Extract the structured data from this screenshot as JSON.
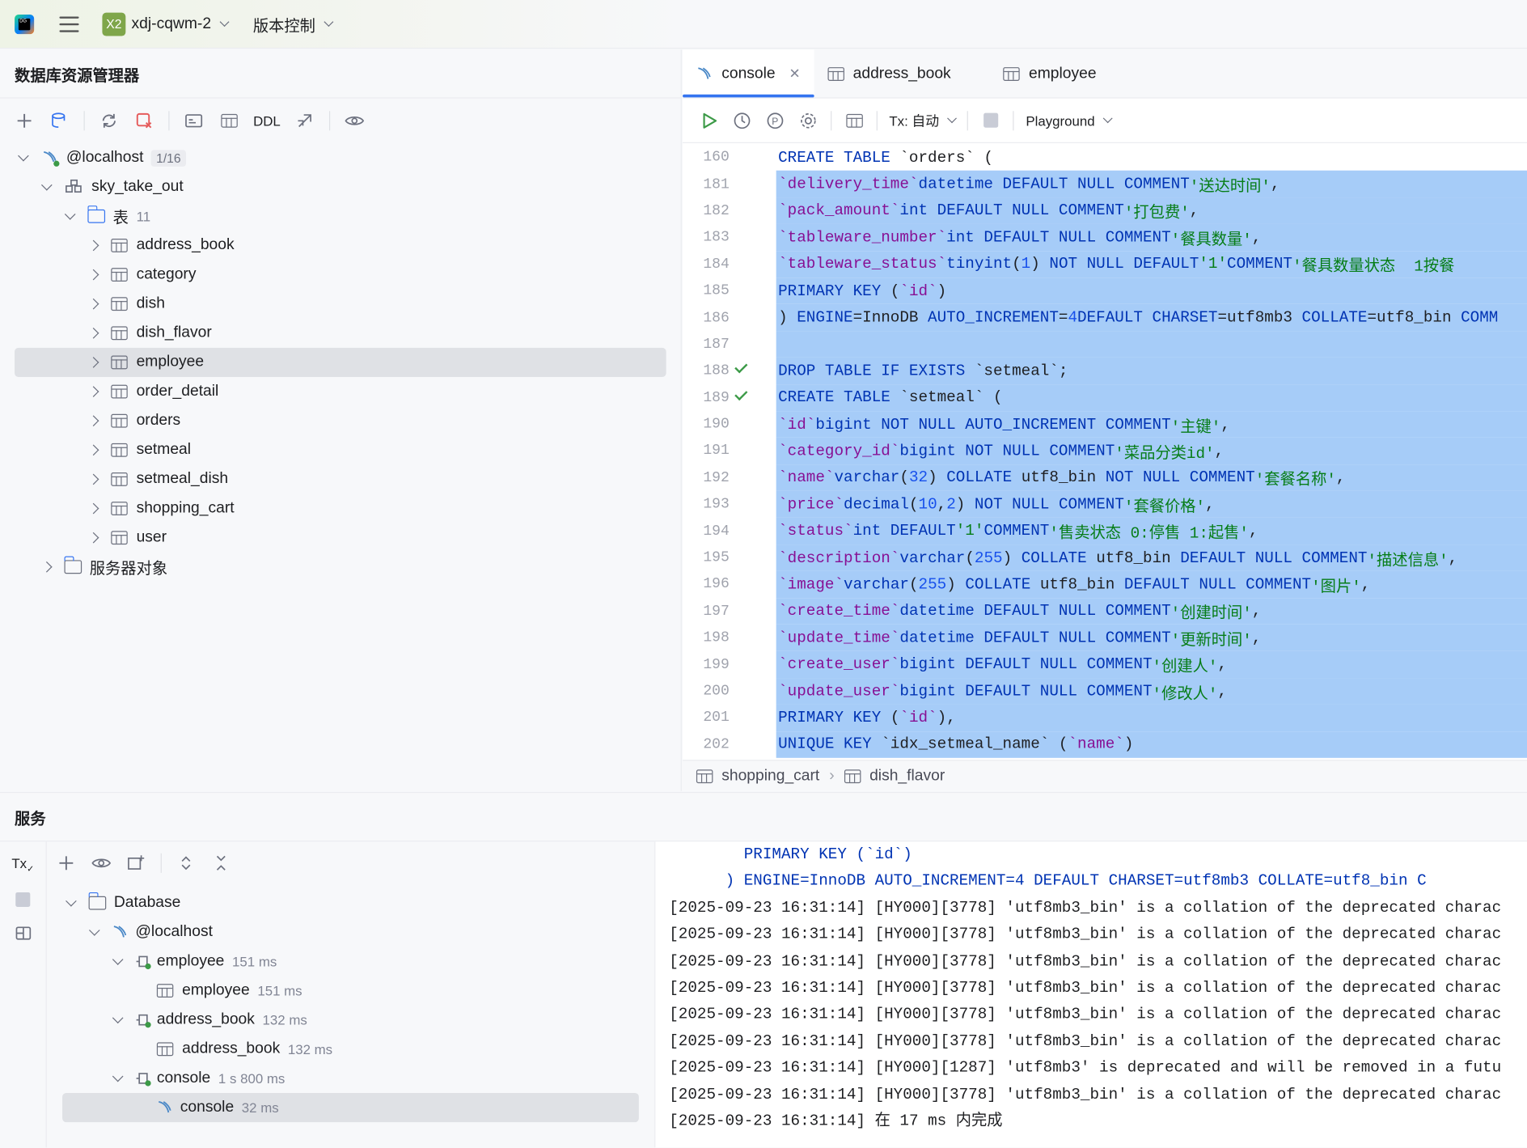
{
  "titlebar": {
    "app_icon_label": "DG",
    "project_badge": "X2",
    "project_name": "xdj-cqwm-2",
    "vcs_label": "版本控制"
  },
  "db_explorer": {
    "title": "数据库资源管理器",
    "toolbar": {
      "ddl_label": "DDL"
    },
    "host": {
      "label": "@localhost",
      "badge": "1/16"
    },
    "schema": "sky_take_out",
    "tables_folder": {
      "label": "表",
      "count": "11"
    },
    "tables": [
      "address_book",
      "category",
      "dish",
      "dish_flavor",
      "employee",
      "order_detail",
      "orders",
      "setmeal",
      "setmeal_dish",
      "shopping_cart",
      "user"
    ],
    "selected_table": "employee",
    "server_objects": "服务器对象"
  },
  "editor": {
    "tabs": [
      {
        "label": "console",
        "active": true
      },
      {
        "label": "address_book"
      },
      {
        "label": "employee"
      }
    ],
    "tx_label": "Tx: 自动",
    "playground_label": "Playground",
    "breadcrumbs": [
      "shopping_cart",
      "dish_flavor"
    ]
  },
  "services": {
    "title": "服务",
    "tx_label": "Tx",
    "tree": {
      "database": "Database",
      "host": "@localhost",
      "items": [
        {
          "name": "employee",
          "time": "151 ms",
          "child": {
            "name": "employee",
            "time": "151 ms"
          }
        },
        {
          "name": "address_book",
          "time": "132 ms",
          "child": {
            "name": "address_book",
            "time": "132 ms"
          }
        },
        {
          "name": "console",
          "time": "1 s 800 ms",
          "child": {
            "name": "console",
            "time": "32 ms"
          }
        }
      ]
    },
    "output": [
      "        PRIMARY KEY (`id`)",
      "      ) ENGINE=InnoDB AUTO_INCREMENT=4 DEFAULT CHARSET=utf8mb3 COLLATE=utf8_bin C",
      "[2025-09-23 16:31:14] [HY000][3778] 'utf8mb3_bin' is a collation of the deprecated charac",
      "[2025-09-23 16:31:14] [HY000][3778] 'utf8mb3_bin' is a collation of the deprecated charac",
      "[2025-09-23 16:31:14] [HY000][3778] 'utf8mb3_bin' is a collation of the deprecated charac",
      "[2025-09-23 16:31:14] [HY000][3778] 'utf8mb3_bin' is a collation of the deprecated charac",
      "[2025-09-23 16:31:14] [HY000][3778] 'utf8mb3_bin' is a collation of the deprecated charac",
      "[2025-09-23 16:31:14] [HY000][3778] 'utf8mb3_bin' is a collation of the deprecated charac",
      "[2025-09-23 16:31:14] [HY000][1287] 'utf8mb3' is deprecated and will be removed in a futu",
      "[2025-09-23 16:31:14] [HY000][3778] 'utf8mb3_bin' is a collation of the deprecated charac",
      "[2025-09-23 16:31:14] 在 17 ms 内完成"
    ]
  },
  "code_lines": [
    {
      "n": "160",
      "hl": false,
      "check": false,
      "html": "<span class='kw'>CREATE TABLE</span> `orders` ("
    },
    {
      "n": "181",
      "hl": true,
      "check": false,
      "html": "  <span class='id'>`delivery_time`</span> <span class='kw'>datetime DEFAULT NULL COMMENT</span> <span class='st'>'送达时间'</span>,"
    },
    {
      "n": "182",
      "hl": true,
      "check": false,
      "html": "  <span class='id'>`pack_amount`</span> <span class='kw'>int DEFAULT NULL COMMENT</span> <span class='st'>'打包费'</span>,"
    },
    {
      "n": "183",
      "hl": true,
      "check": false,
      "html": "  <span class='id'>`tableware_number`</span> <span class='kw'>int DEFAULT NULL COMMENT</span> <span class='st'>'餐具数量'</span>,"
    },
    {
      "n": "184",
      "hl": true,
      "check": false,
      "html": "  <span class='id'>`tableware_status`</span> <span class='kw'>tinyint</span>(<span class='nm'>1</span>) <span class='kw'>NOT NULL DEFAULT</span> <span class='st'>'1'</span> <span class='kw'>COMMENT</span> <span class='st'>'餐具数量状态  1按餐</span>"
    },
    {
      "n": "185",
      "hl": true,
      "check": false,
      "html": "  <span class='kw'>PRIMARY KEY</span> (<span class='id'>`id`</span>)"
    },
    {
      "n": "186",
      "hl": true,
      "check": false,
      "html": ") <span class='kw'>ENGINE</span>=InnoDB <span class='kw'>AUTO_INCREMENT</span>=<span class='nm'>4</span> <span class='kw'>DEFAULT CHARSET</span>=utf8mb3 <span class='kw'>COLLATE</span>=utf8_bin <span class='kw'>COMM</span>"
    },
    {
      "n": "187",
      "hl": true,
      "check": false,
      "html": ""
    },
    {
      "n": "188",
      "hl": true,
      "check": true,
      "html": "<span class='kw'>DROP TABLE IF EXISTS</span> `setmeal`;"
    },
    {
      "n": "189",
      "hl": true,
      "check": true,
      "html": "<span class='kw'>CREATE TABLE</span> `setmeal` ("
    },
    {
      "n": "190",
      "hl": true,
      "check": false,
      "html": "  <span class='id'>`id`</span> <span class='kw'>bigint NOT NULL AUTO_INCREMENT COMMENT</span> <span class='st'>'主键'</span>,"
    },
    {
      "n": "191",
      "hl": true,
      "check": false,
      "html": "  <span class='id'>`category_id`</span> <span class='kw'>bigint NOT NULL COMMENT</span> <span class='st'>'菜品分类id'</span>,"
    },
    {
      "n": "192",
      "hl": true,
      "check": false,
      "html": "  <span class='id'>`name`</span> <span class='kw'>varchar</span>(<span class='nm'>32</span>) <span class='kw'>COLLATE</span> utf8_bin <span class='kw'>NOT NULL COMMENT</span> <span class='st'>'套餐名称'</span>,"
    },
    {
      "n": "193",
      "hl": true,
      "check": false,
      "html": "  <span class='id'>`price`</span> <span class='kw'>decimal</span>(<span class='nm'>10</span>,<span class='nm'>2</span>) <span class='kw'>NOT NULL COMMENT</span> <span class='st'>'套餐价格'</span>,"
    },
    {
      "n": "194",
      "hl": true,
      "check": false,
      "html": "  <span class='id'>`status`</span> <span class='kw'>int DEFAULT</span> <span class='st'>'1'</span> <span class='kw'>COMMENT</span> <span class='st'>'售卖状态 0:停售 1:起售'</span>,"
    },
    {
      "n": "195",
      "hl": true,
      "check": false,
      "html": "  <span class='id'>`description`</span> <span class='kw'>varchar</span>(<span class='nm'>255</span>) <span class='kw'>COLLATE</span> utf8_bin <span class='kw'>DEFAULT NULL COMMENT</span> <span class='st'>'描述信息'</span>,"
    },
    {
      "n": "196",
      "hl": true,
      "check": false,
      "html": "  <span class='id'>`image`</span> <span class='kw'>varchar</span>(<span class='nm'>255</span>) <span class='kw'>COLLATE</span> utf8_bin <span class='kw'>DEFAULT NULL COMMENT</span> <span class='st'>'图片'</span>,"
    },
    {
      "n": "197",
      "hl": true,
      "check": false,
      "html": "  <span class='id'>`create_time`</span> <span class='kw'>datetime DEFAULT NULL COMMENT</span> <span class='st'>'创建时间'</span>,"
    },
    {
      "n": "198",
      "hl": true,
      "check": false,
      "html": "  <span class='id'>`update_time`</span> <span class='kw'>datetime DEFAULT NULL COMMENT</span> <span class='st'>'更新时间'</span>,"
    },
    {
      "n": "199",
      "hl": true,
      "check": false,
      "html": "  <span class='id'>`create_user`</span> <span class='kw'>bigint DEFAULT NULL COMMENT</span> <span class='st'>'创建人'</span>,"
    },
    {
      "n": "200",
      "hl": true,
      "check": false,
      "html": "  <span class='id'>`update_user`</span> <span class='kw'>bigint DEFAULT NULL COMMENT</span> <span class='st'>'修改人'</span>,"
    },
    {
      "n": "201",
      "hl": true,
      "check": false,
      "html": "  <span class='kw'>PRIMARY KEY</span> (<span class='id'>`id`</span>),"
    },
    {
      "n": "202",
      "hl": true,
      "check": false,
      "html": "  <span class='kw'>UNIQUE KEY</span> `idx_setmeal_name` (<span class='id'>`name`</span>)"
    }
  ]
}
